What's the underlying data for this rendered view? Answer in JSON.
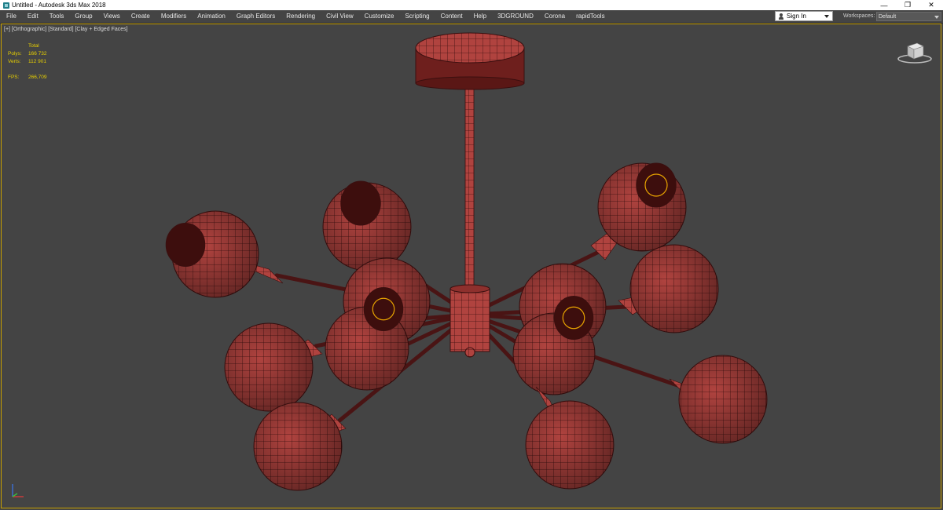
{
  "window": {
    "title": "Untitled - Autodesk 3ds Max 2018",
    "minimize_glyph": "—",
    "restore_glyph": "❐",
    "close_glyph": "✕"
  },
  "menu": {
    "items": [
      "File",
      "Edit",
      "Tools",
      "Group",
      "Views",
      "Create",
      "Modifiers",
      "Animation",
      "Graph Editors",
      "Rendering",
      "Civil View",
      "Customize",
      "Scripting",
      "Content",
      "Help",
      "3DGROUND",
      "Corona",
      "rapidTools"
    ]
  },
  "account": {
    "signin_label": "Sign In",
    "workspaces_label": "Workspaces:",
    "workspace_value": "Default"
  },
  "viewport": {
    "label": "[+] [Orthographic] [Standard] [Clay + Edged Faces]",
    "stats": {
      "header": "Total",
      "polys_label": "Polys:",
      "polys_value": "166 732",
      "verts_label": "Verts:",
      "verts_value": "112 901",
      "fps_label": "FPS:",
      "fps_value": "266,709"
    }
  },
  "colors": {
    "viewport_bg": "#444444",
    "model_fill": "#b0433f",
    "model_wire": "#3a0f0f",
    "stats_text": "#e8d000",
    "viewport_border": "#c8a000"
  },
  "icons": [
    "app-icon",
    "user-icon",
    "dropdown-arrow-icon",
    "viewcube-icon",
    "axis-tripod-icon"
  ]
}
